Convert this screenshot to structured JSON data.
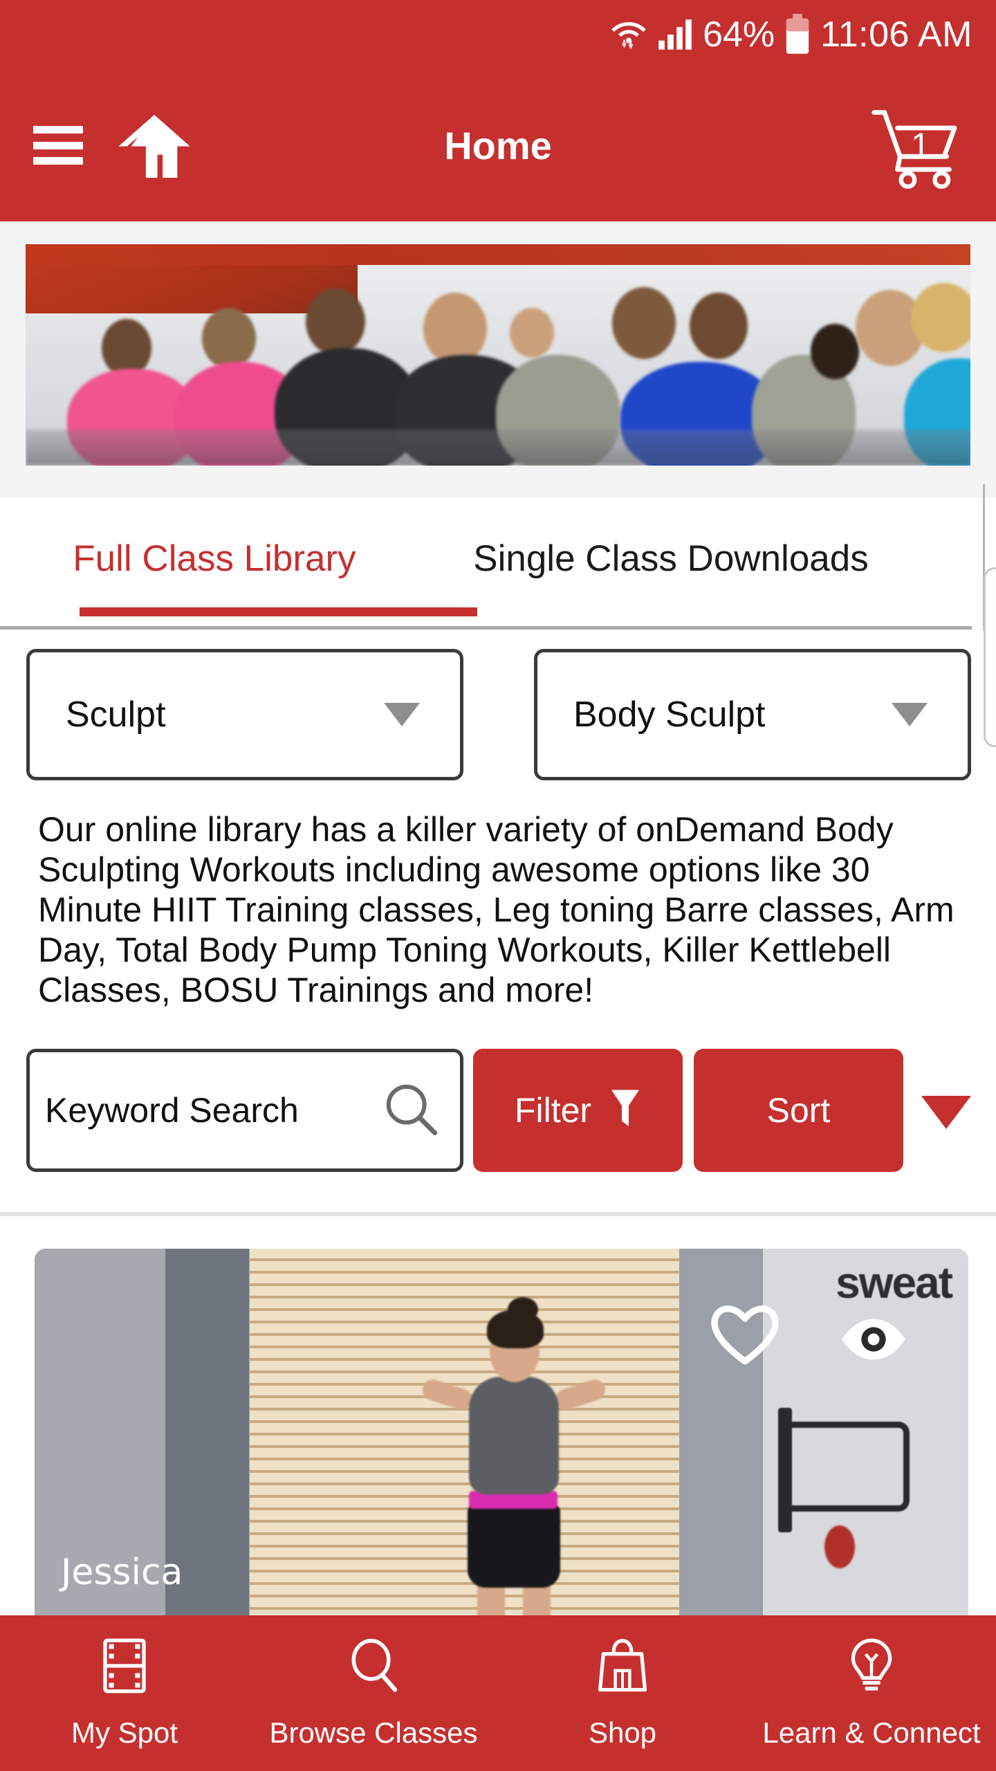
{
  "statusbar": {
    "wifi_icon": "wifi-icon",
    "signal_icon": "signal-bars-icon",
    "battery_percent": "64%",
    "battery_icon": "battery-icon",
    "time": "11:06 AM"
  },
  "header": {
    "menu_icon": "hamburger-menu-icon",
    "home_icon": "home-icon",
    "title": "Home",
    "cart_icon": "shopping-cart-icon",
    "cart_count": "1"
  },
  "hero": {
    "alt": "group cycling class banner"
  },
  "tabs": [
    {
      "label": "Full Class Library",
      "active": true
    },
    {
      "label": "Single Class Downloads",
      "active": false
    }
  ],
  "filters": {
    "category_dropdown": {
      "value": "Sculpt",
      "caret_icon": "chevron-down-icon"
    },
    "subcategory_dropdown": {
      "value": "Body Sculpt",
      "caret_icon": "chevron-down-icon"
    }
  },
  "description": "Our online library has a killer variety of onDemand Body Sculpting Workouts including awesome options like 30 Minute HIIT Training classes, Leg toning Barre classes, Arm Day, Total Body Pump Toning Workouts, Killer Kettlebell Classes, BOSU Trainings and more!",
  "search": {
    "placeholder": "Keyword Search",
    "value": "",
    "search_icon": "search-icon"
  },
  "actions": {
    "filter_label": "Filter",
    "filter_icon": "funnel-icon",
    "sort_label": "Sort",
    "sort_caret_icon": "caret-down-icon"
  },
  "class_card": {
    "instructor": "Jessica",
    "favorite_icon": "heart-icon",
    "preview_icon": "eye-icon",
    "brand_logo": "sweat"
  },
  "bottom_nav": [
    {
      "label": "My Spot",
      "icon": "film-strip-icon"
    },
    {
      "label": "Browse Classes",
      "icon": "search-icon"
    },
    {
      "label": "Shop",
      "icon": "shopping-bag-icon"
    },
    {
      "label": "Learn & Connect",
      "icon": "lightbulb-icon"
    }
  ],
  "colors": {
    "brand_red": "#c5302f",
    "text_dark": "#111111",
    "divider_gray": "#a8a8a8"
  }
}
